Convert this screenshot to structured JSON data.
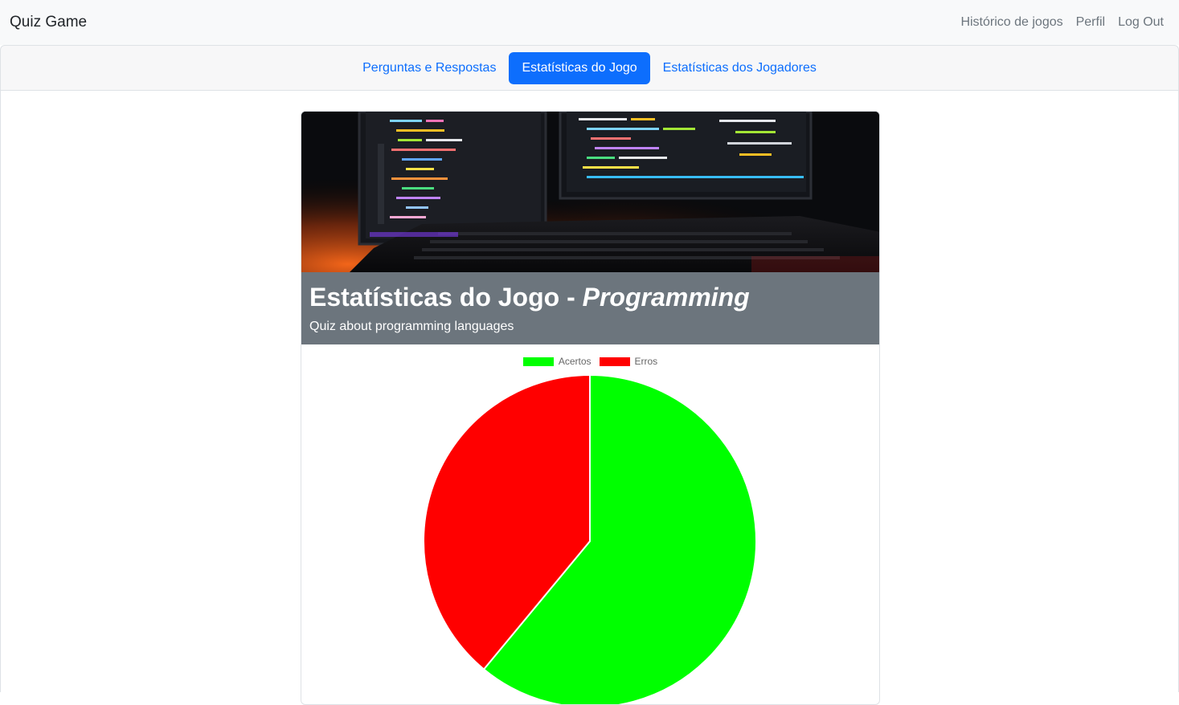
{
  "navbar": {
    "brand": "Quiz Game",
    "links": [
      "Histórico de jogos",
      "Perfil",
      "Log Out"
    ]
  },
  "tabs": [
    {
      "label": "Perguntas e Respostas",
      "active": false
    },
    {
      "label": "Estatísticas do Jogo",
      "active": true
    },
    {
      "label": "Estatísticas dos Jogadores",
      "active": false
    }
  ],
  "card": {
    "title_prefix": "Estatísticas do Jogo - ",
    "title_emph": "Programming",
    "subtitle": "Quiz about programming languages",
    "header_band_color": "#6c757d"
  },
  "colors": {
    "accent": "#0d6efd",
    "correct": "#00ff00",
    "wrong": "#ff0000"
  },
  "chart_data": {
    "type": "pie",
    "categories": [
      "Acertos",
      "Erros"
    ],
    "values": [
      61,
      39
    ],
    "colors": [
      "#00ff00",
      "#ff0000"
    ],
    "legend_position": "top"
  }
}
